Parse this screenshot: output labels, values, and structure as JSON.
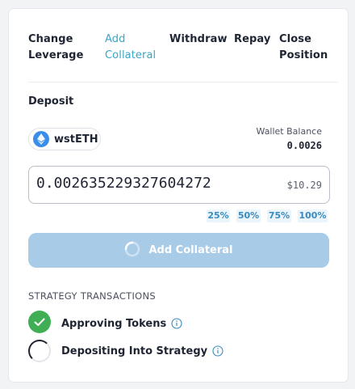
{
  "tabs": [
    {
      "label": "Change\nLeverage",
      "active": false
    },
    {
      "label": "Add\nCollateral",
      "active": true
    },
    {
      "label": "Withdraw",
      "active": false
    },
    {
      "label": "Repay",
      "active": false
    },
    {
      "label": "Close\nPosition",
      "active": false
    }
  ],
  "deposit": {
    "label": "Deposit",
    "token": {
      "name": "wstETH",
      "icon": "ethereum-icon"
    },
    "wallet_balance_label": "Wallet Balance",
    "wallet_balance_value": "0.0026",
    "amount": "0.002635229327604272",
    "amount_usd": "$10.29",
    "percent_buttons": [
      "25%",
      "50%",
      "75%",
      "100%"
    ]
  },
  "action_button": {
    "label": "Add Collateral",
    "state": "loading",
    "icon": "spinner-icon"
  },
  "strategy": {
    "heading": "STRATEGY TRANSACTIONS",
    "steps": [
      {
        "label": "Approving Tokens",
        "status": "complete",
        "icon": "checkmark-icon"
      },
      {
        "label": "Depositing Into Strategy",
        "status": "in-progress",
        "icon": "spinner-icon"
      }
    ]
  },
  "colors": {
    "accent": "#3aa6c8",
    "button_disabled": "#a8cbe8",
    "success": "#3fae55",
    "token_blue": "#3b8ee8",
    "percent_text": "#3a8bbd",
    "percent_bg": "#eaf4fb"
  }
}
